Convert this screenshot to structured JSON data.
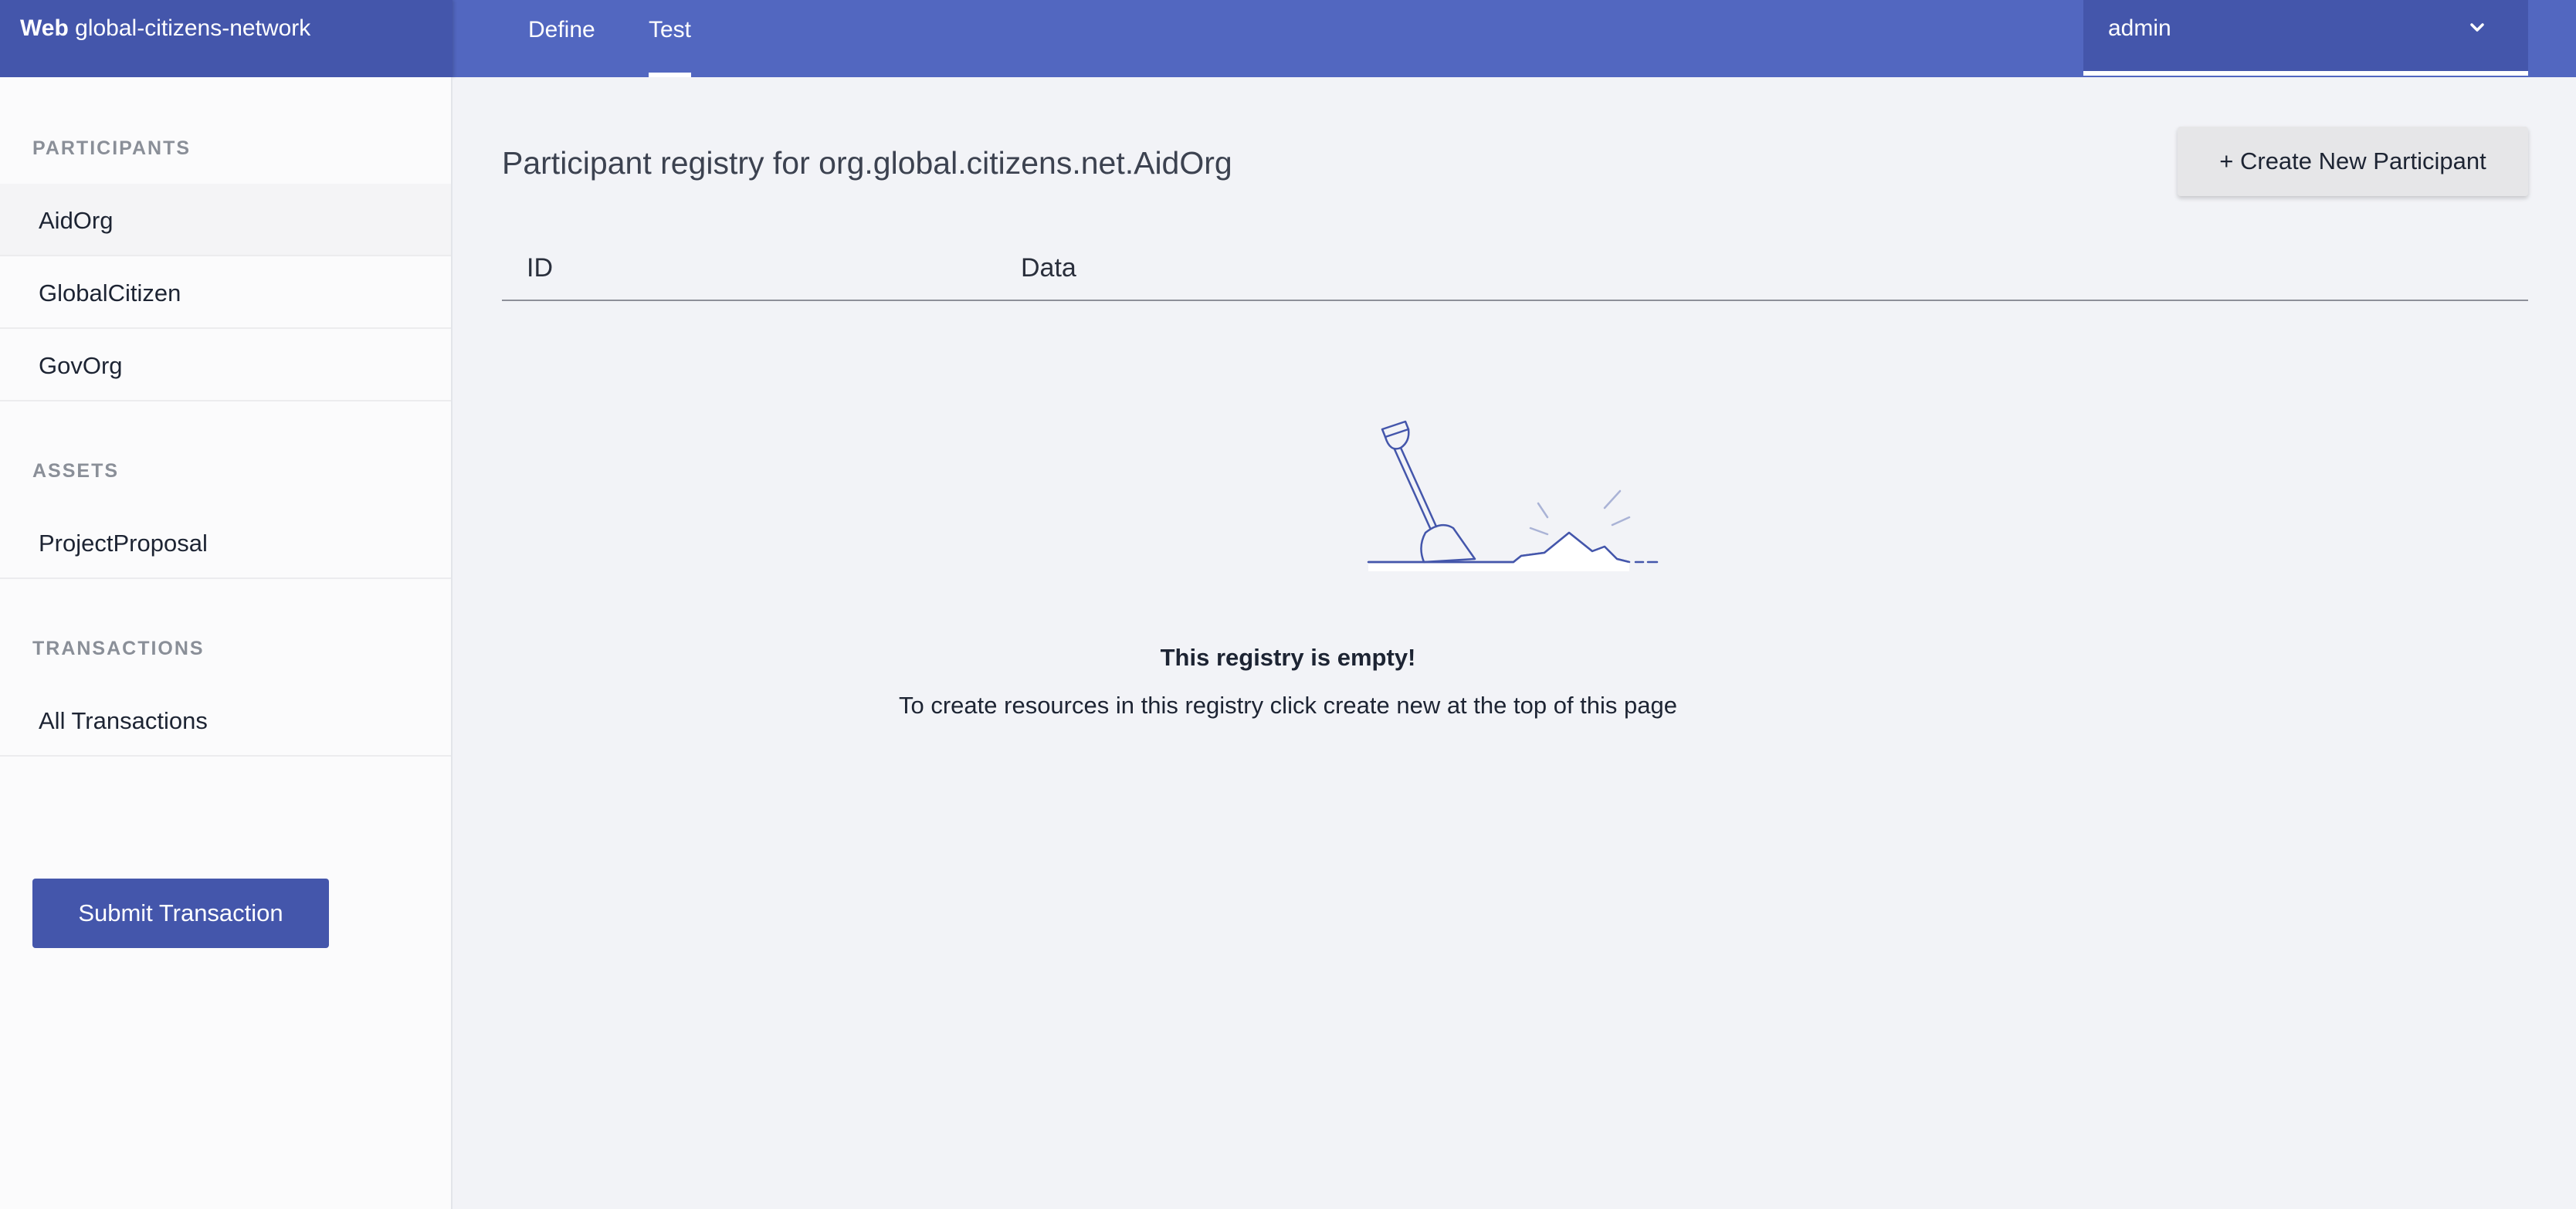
{
  "header": {
    "brand_bold": "Web",
    "brand_name": "global-citizens-network",
    "tabs": [
      {
        "label": "Define",
        "active": false
      },
      {
        "label": "Test",
        "active": true
      }
    ],
    "user": "admin"
  },
  "sidebar": {
    "sections": [
      {
        "title": "PARTICIPANTS",
        "items": [
          "AidOrg",
          "GlobalCitizen",
          "GovOrg"
        ]
      },
      {
        "title": "ASSETS",
        "items": [
          "ProjectProposal"
        ]
      },
      {
        "title": "TRANSACTIONS",
        "items": [
          "All Transactions"
        ]
      }
    ],
    "active_item": "AidOrg",
    "submit_label": "Submit Transaction"
  },
  "main": {
    "title": "Participant registry for org.global.citizens.net.AidOrg",
    "create_label": "+ Create New Participant",
    "columns": [
      "ID",
      "Data"
    ],
    "empty_title": "This registry is empty!",
    "empty_desc": "To create resources in this registry click create new at the top of this page"
  },
  "colors": {
    "header_bg": "#5267c0",
    "header_dark": "#4456ab",
    "page_bg": "#f2f3f7"
  }
}
